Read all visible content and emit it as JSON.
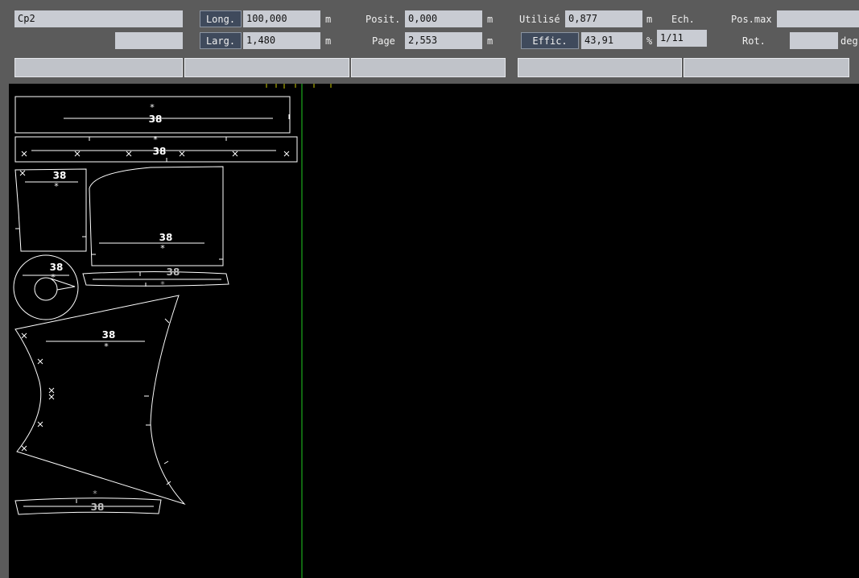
{
  "toolbar": {
    "marker_name": "Cp2",
    "secondary_field": "",
    "length": {
      "label": "Long.",
      "value": "100,000",
      "unit": "m"
    },
    "width": {
      "label": "Larg.",
      "value": "1,480",
      "unit": "m"
    },
    "position": {
      "label": "Posit.",
      "value": "0,000",
      "unit": "m"
    },
    "page": {
      "label": "Page",
      "value": "2,553",
      "unit": "m"
    },
    "used": {
      "label": "Utilisé",
      "value": "0,877",
      "unit": "m"
    },
    "efficiency": {
      "label": "Effic.",
      "value": "43,91",
      "unit": "%"
    },
    "scale": {
      "label": "Ech.",
      "value": "1/11"
    },
    "pos_max": {
      "label": "Pos.max",
      "value": ""
    },
    "rotation": {
      "label": "Rot.",
      "value": "",
      "unit": "deg"
    }
  },
  "marker": {
    "piece_size_label": "38",
    "grain_mark": "*",
    "notch_mark": "×"
  },
  "colors": {
    "background": "#000000",
    "piece_outline": "#ffffff",
    "guide_line": "#22cc22",
    "tick_mark": "#cccc00"
  }
}
